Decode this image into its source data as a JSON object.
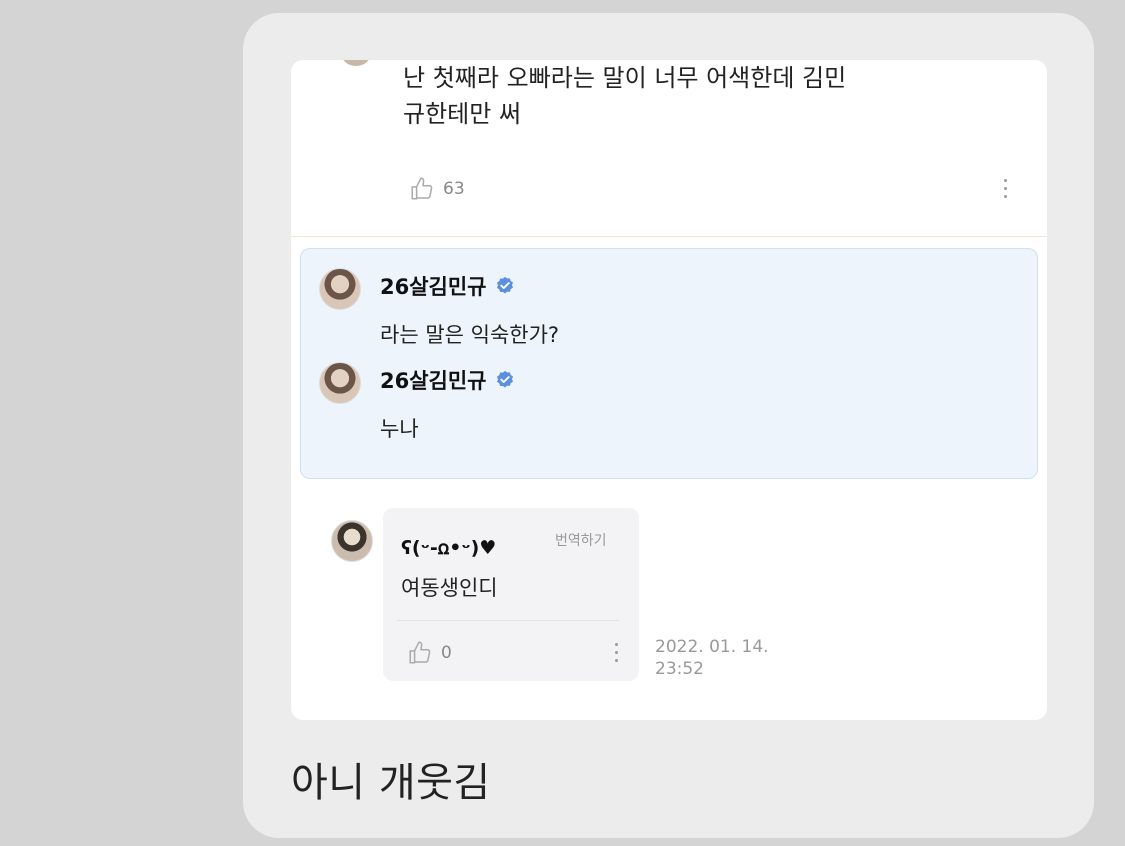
{
  "caption": "아니 개웃김",
  "top_comment": {
    "text_line1": "난 첫째라 오빠라는 말이 너무 어색한데 김민",
    "text_line2": "규한테만 써",
    "likes": "63"
  },
  "highlight": {
    "comments": [
      {
        "username": "26살김민규",
        "message": "라는 말은 익숙한가?"
      },
      {
        "username": "26살김민규",
        "message": "누나"
      }
    ]
  },
  "reply": {
    "username": "ʕ(ᵕ-ꭥ•ᵕ)♥",
    "translate_label": "번역하기",
    "message": "여동생인디",
    "likes": "0",
    "date": "2022. 01. 14.",
    "time": "23:52"
  },
  "colors": {
    "highlight_bg": "#eef4fb",
    "verified_badge": "#5b8fe0"
  },
  "icons": [
    "thumbs-up-icon",
    "more-vertical-icon",
    "verified-badge-icon"
  ]
}
